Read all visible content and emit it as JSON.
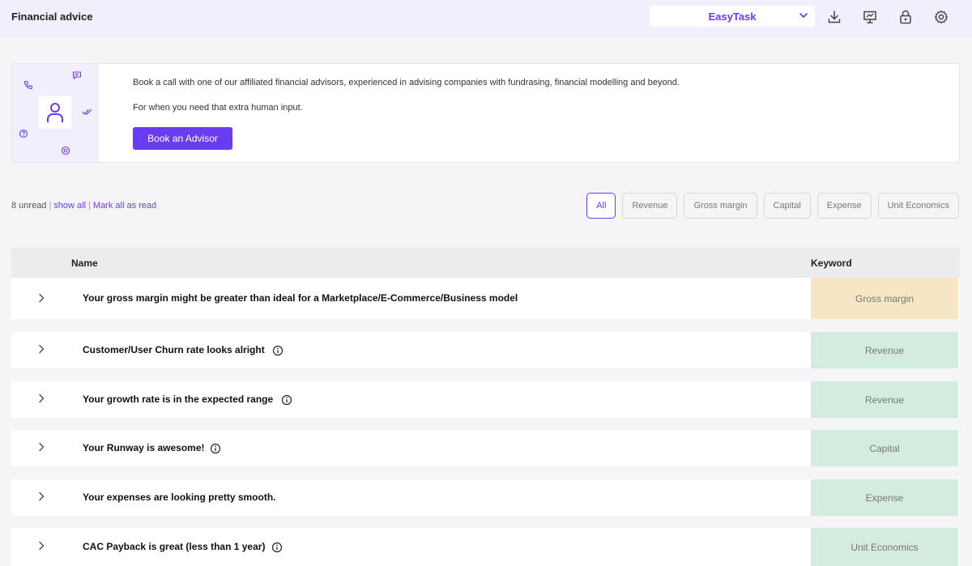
{
  "header": {
    "title": "Financial advice",
    "company": "EasyTask",
    "icons": [
      "chevron-down-icon",
      "download-icon",
      "presentation-icon",
      "lock-icon",
      "gear-icon"
    ]
  },
  "banner": {
    "line1": "Book a call with one of our affiliated financial advisors, experienced in advising companies with fundrasing, financial modelling and beyond.",
    "line2": "For when you need that extra human input.",
    "button_label": "Book an Advisor"
  },
  "filter": {
    "unread": "8 unread",
    "show_all": "show all",
    "mark_all": "Mark all as read",
    "chips": [
      "All",
      "Revenue",
      "Gross margin",
      "Capital",
      "Expense",
      "Unit Economics"
    ],
    "active": "All"
  },
  "table": {
    "col_name": "Name",
    "col_keyword": "Keyword",
    "rows": [
      {
        "name": "Your gross margin might be greater than ideal for a Marketplace/E-Commerce/Business model",
        "keyword": "Gross margin",
        "info": false
      },
      {
        "name": "Customer/User Churn rate looks alright",
        "keyword": "Revenue",
        "info": true
      },
      {
        "name": "Your growth rate is in the expected range",
        "keyword": "Revenue",
        "info": true
      },
      {
        "name": "Your Runway is awesome!",
        "keyword": "Capital",
        "info": true
      },
      {
        "name": "Your expenses are looking pretty smooth.",
        "keyword": "Expense",
        "info": false
      },
      {
        "name": "CAC Payback is great (less than 1 year)",
        "keyword": "Unit Economics",
        "info": true
      }
    ]
  },
  "colors": {
    "accent": "#6a3cf0",
    "header_bg": "#f1effc",
    "gross_margin_bg": "#f7e6c4",
    "positive_bg": "#d4ece0"
  }
}
